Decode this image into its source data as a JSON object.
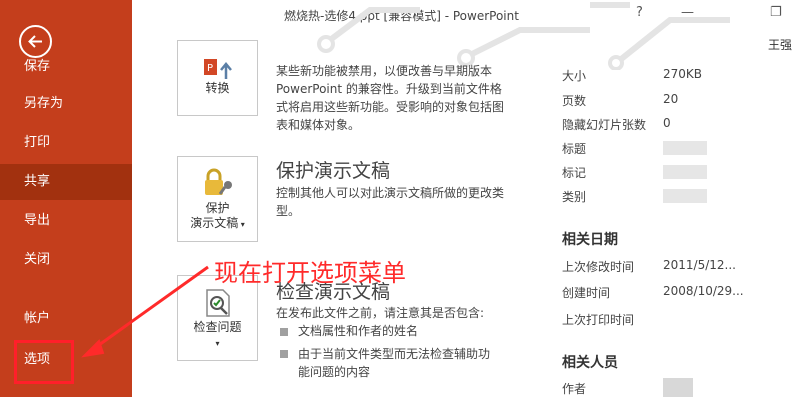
{
  "window": {
    "title": "燃烧热-选修4.ppt [兼容模式] - PowerPoint",
    "help": "?",
    "minimize": "—",
    "restore": "❐",
    "user": "王强"
  },
  "sidebar": {
    "items": [
      {
        "label": "保存"
      },
      {
        "label": "另存为"
      },
      {
        "label": "打印"
      },
      {
        "label": "共享"
      },
      {
        "label": "导出"
      },
      {
        "label": "关闭"
      },
      {
        "label": "帐户"
      },
      {
        "label": "选项"
      }
    ]
  },
  "compat": {
    "button_label": "转换",
    "desc": "某些新功能被禁用，以便改善与早期版本 PowerPoint 的兼容性。升级到当前文件格式将启用这些新功能。受影响的对象包括图表和媒体对象。"
  },
  "protect": {
    "title": "保护演示文稿",
    "button_label_1": "保护",
    "button_label_2": "演示文稿",
    "desc": "控制其他人可以对此演示文稿所做的更改类型。"
  },
  "inspect": {
    "title": "检查演示文稿",
    "button_label": "检查问题",
    "desc": "在发布此文件之前，请注意其是否包含:",
    "bullets": [
      "文档属性和作者的姓名",
      "由于当前文件类型而无法检查辅助功能问题的内容"
    ]
  },
  "annotation": {
    "text": "现在打开选项菜单",
    "color": "#ff2a2a"
  },
  "properties": {
    "items": [
      {
        "label": "大小",
        "value": "270KB"
      },
      {
        "label": "页数",
        "value": "20"
      },
      {
        "label": "隐藏幻灯片张数",
        "value": "0"
      },
      {
        "label": "标题",
        "value": ""
      },
      {
        "label": "标记",
        "value": ""
      },
      {
        "label": "类别",
        "value": ""
      }
    ],
    "dates_heading": "相关日期",
    "dates": [
      {
        "label": "上次修改时间",
        "value": "2011/5/12..."
      },
      {
        "label": "创建时间",
        "value": "2008/10/29..."
      },
      {
        "label": "上次打印时间",
        "value": ""
      }
    ],
    "people_heading": "相关人员",
    "author_label": "作者"
  },
  "colors": {
    "sidebar": "#c43e1c",
    "sidebar_selected": "#a2310f",
    "annotation": "#ff2a2a"
  }
}
